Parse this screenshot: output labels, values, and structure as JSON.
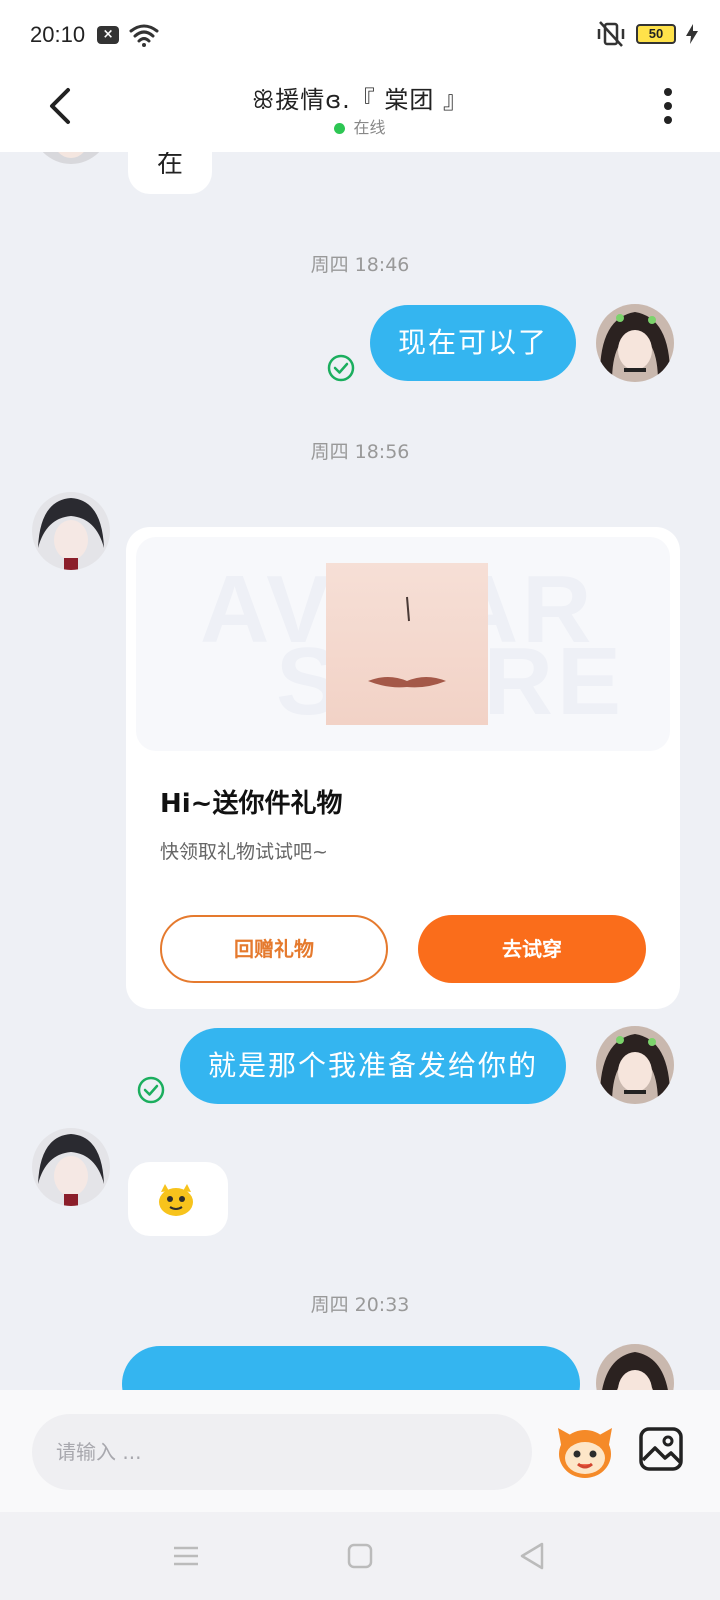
{
  "status_bar": {
    "time": "20:10",
    "battery_level": "50"
  },
  "header": {
    "title": "ꕥ援情ɞ.『 棠团 』",
    "status": "在线"
  },
  "messages": {
    "first_left_text": "在",
    "timestamp_1": "周四 18:46",
    "right_1_text": "现在可以了",
    "timestamp_2": "周四 18:56",
    "gift_card": {
      "watermark_1": "AVATAR",
      "watermark_2": "STORE",
      "title": "Hi~送你件礼物",
      "subtitle": "快领取礼物试试吧~",
      "return_gift_label": "回赠礼物",
      "try_on_label": "去试穿"
    },
    "right_2_text": "就是那个我准备发给你的",
    "timestamp_3": "周四 20:33"
  },
  "input": {
    "placeholder": "请输入 ..."
  },
  "colors": {
    "accent_blue": "#34b5f0",
    "accent_orange": "#fa6d1b",
    "online_green": "#2dc653",
    "check_green": "#1bae5e"
  }
}
